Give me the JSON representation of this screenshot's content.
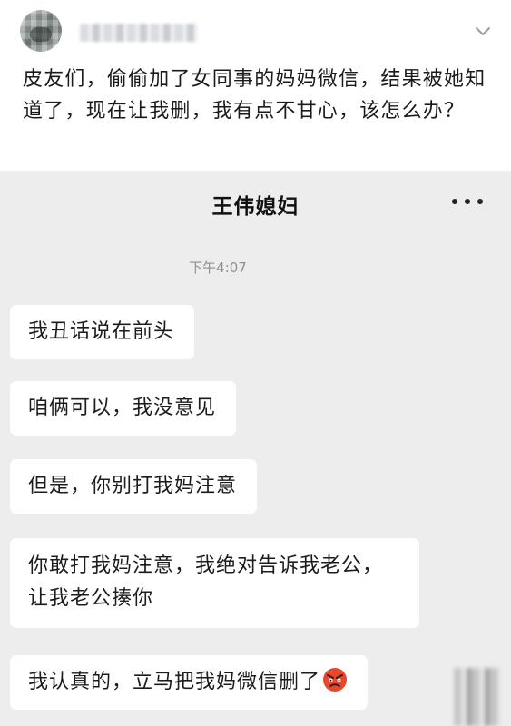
{
  "post": {
    "text": "皮友们，偷偷加了女同事的妈妈微信，结果被她知道了，现在让我删，我有点不甘心，该怎么办？"
  },
  "chat": {
    "title": "王伟媳妇",
    "timestamp": "下午4:07",
    "messages": [
      {
        "text": "我丑话说在前头"
      },
      {
        "text": "咱俩可以，我没意见"
      },
      {
        "text": "但是，你别打我妈注意"
      },
      {
        "text": "你敢打我妈注意，我绝对告诉我老公，让我老公揍你"
      },
      {
        "text": "我认真的，立马把我妈微信删了",
        "emoji": "angry-face-icon"
      }
    ]
  },
  "colors": {
    "chat_background": "#ededed",
    "bubble_background": "#ffffff",
    "timestamp_text": "#8f8f8f",
    "emoji_red": "#e5482f"
  }
}
